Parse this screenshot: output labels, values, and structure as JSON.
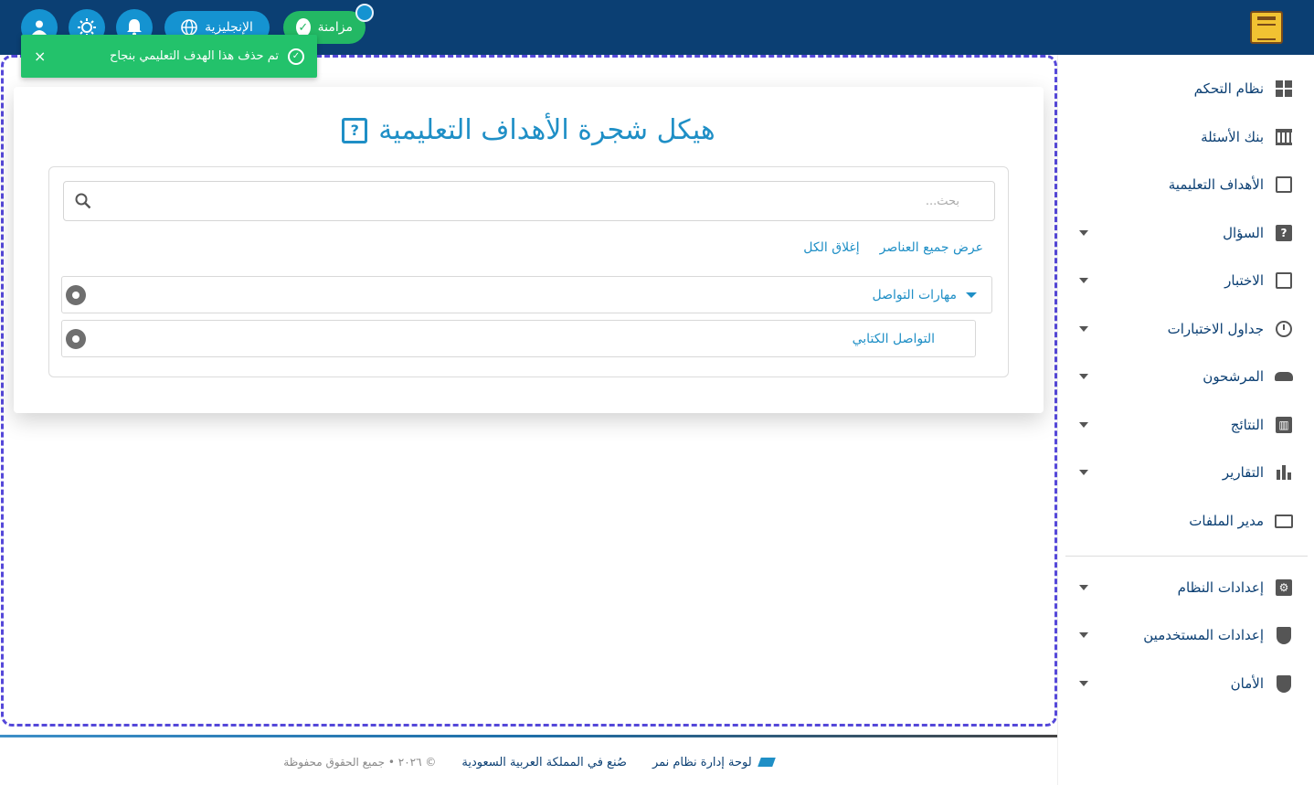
{
  "header": {
    "sync_label": "مزامنة",
    "language_label": "الإنجليزية",
    "icons": [
      "globe-icon",
      "notification-bell-icon",
      "theme-toggle-icon",
      "user-account-icon",
      "app-logo"
    ]
  },
  "toast": {
    "message": "تم حذف هذا الهدف التعليمي بنجاح",
    "close_symbol": "×",
    "check_symbol": "✓"
  },
  "main": {
    "title": "هيكل شجرة الأهداف التعليمية",
    "title_icon_symbol": "?",
    "search": {
      "placeholder": "بحث..."
    },
    "actions": {
      "show_all": "عرض جميع العناصر",
      "close_all": "إغلاق الكل"
    },
    "tree": [
      {
        "label": "مهارات التواصل",
        "expanded": true
      },
      {
        "label": "التواصل الكتابي",
        "expanded": false
      }
    ]
  },
  "sidebar": {
    "items": [
      {
        "label": "نظام التحكم",
        "icon": "dashboard-icon",
        "has_submenu": false
      },
      {
        "label": "بنك الأسئلة",
        "icon": "bank-icon",
        "has_submenu": false
      },
      {
        "label": "الأهداف التعليمية",
        "icon": "objectives-icon",
        "has_submenu": false
      },
      {
        "label": "السؤال",
        "icon": "question-icon",
        "has_submenu": true
      },
      {
        "label": "الاختبار",
        "icon": "exam-icon",
        "has_submenu": true
      },
      {
        "label": "جداول الاختبارات",
        "icon": "clock-icon",
        "has_submenu": true
      },
      {
        "label": "المرشحون",
        "icon": "people-icon",
        "has_submenu": true
      },
      {
        "label": "النتائج",
        "icon": "results-chart-icon",
        "has_submenu": true
      },
      {
        "label": "التقارير",
        "icon": "bar-chart-icon",
        "has_submenu": true
      },
      {
        "label": "مدير الملفات",
        "icon": "folder-icon",
        "has_submenu": false
      },
      {
        "label": "إعدادات النظام",
        "icon": "settings-icon",
        "has_submenu": true
      },
      {
        "label": "إعدادات المستخدمين",
        "icon": "user-shield-icon",
        "has_submenu": true
      },
      {
        "label": "الأمان",
        "icon": "shield-icon",
        "has_submenu": true
      }
    ]
  },
  "footer": {
    "brand": "لوحة إدارة نظام نمر",
    "made_in": "صُنع في المملكة العربية السعودية",
    "copyright": "© ٢٠٢٦ • جميع الحقوق محفوظة"
  },
  "colors": {
    "topbar": "#0b3f73",
    "accent": "#1f8fc6",
    "success": "#23b864",
    "frame_dash": "#5548d9"
  }
}
